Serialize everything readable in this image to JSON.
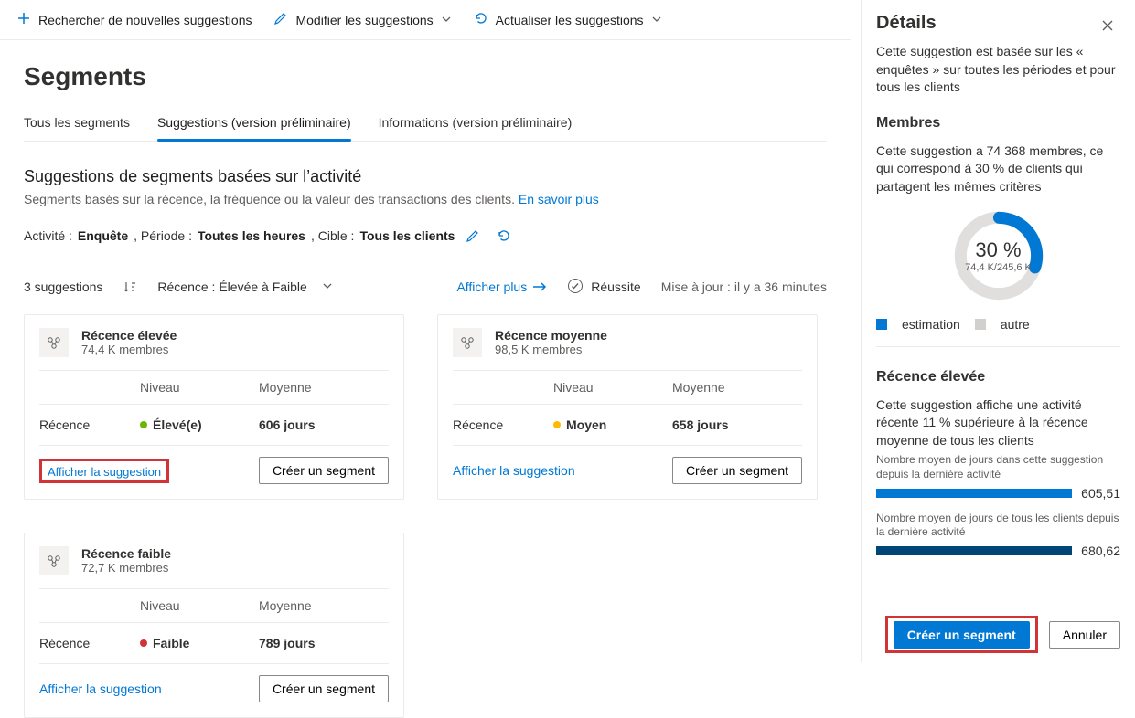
{
  "toolbar": {
    "search": "Rechercher de nouvelles suggestions",
    "modify": "Modifier les suggestions",
    "refresh": "Actualiser les suggestions"
  },
  "page": {
    "title": "Segments"
  },
  "tabs": {
    "all": "Tous les segments",
    "suggestions": "Suggestions (version préliminaire)",
    "insights": "Informations (version préliminaire)"
  },
  "section": {
    "title": "Suggestions de segments basées sur l’activité",
    "desc": "Segments basés sur la récence, la fréquence ou la valeur des transactions des clients. ",
    "learn_more": "En savoir plus"
  },
  "filters": {
    "activity_label": "Activité : ",
    "activity_value": "Enquête",
    "period_label": ", Période : ",
    "period_value": "Toutes les heures",
    "target_label": ", Cible : ",
    "target_value": "Tous les clients"
  },
  "list": {
    "count_text": "3 suggestions",
    "sort_text": "Récence : Élevée à Faible",
    "show_more": "Afficher plus",
    "status": "Réussite",
    "updated_label": "Mise à jour : ",
    "updated_value": "il y a 36 minutes"
  },
  "headers": {
    "level": "Niveau",
    "avg": "Moyenne",
    "rec": "Récence"
  },
  "card_actions": {
    "view": "Afficher la suggestion",
    "create": "Créer un segment"
  },
  "cards": [
    {
      "title": "Récence élevée",
      "members": "74,4 K membres",
      "level": "Élevé(e)",
      "avg": "606 jours",
      "dot": "green",
      "highlighted": true
    },
    {
      "title": "Récence moyenne",
      "members": "98,5 K membres",
      "level": "Moyen",
      "avg": "658 jours",
      "dot": "yellow",
      "highlighted": false
    },
    {
      "title": "Récence faible",
      "members": "72,7 K membres",
      "level": "Faible",
      "avg": "789 jours",
      "dot": "red",
      "highlighted": false
    }
  ],
  "pane": {
    "title": "Détails",
    "intro": "Cette suggestion est basée sur les « enquêtes » sur toutes les périodes et pour tous les clients",
    "members_title": "Membres",
    "members_desc": "Cette suggestion a 74 368 membres, ce qui correspond à 30 % de clients qui partagent les mêmes critères",
    "donut_pct": "30 %",
    "donut_sub": "74,4 K/245,6 K",
    "legend_est": "estimation",
    "legend_other": "autre",
    "rec_title": "Récence élevée",
    "rec_desc": "Cette suggestion affiche une activité récente 11 % supérieure à la récence moyenne de tous les clients",
    "metric1_label": "Nombre moyen de jours dans cette suggestion depuis la dernière activité",
    "metric1_value": "605,51",
    "metric2_label": "Nombre moyen de jours de tous les clients depuis la dernière activité",
    "metric2_value": "680,62",
    "create": "Créer un segment",
    "cancel": "Annuler"
  },
  "chart_data": {
    "type": "pie",
    "title": "Membres",
    "series": [
      {
        "name": "estimation",
        "value": 74.4,
        "pct": 30,
        "color": "#0078d4"
      },
      {
        "name": "autre",
        "value": 171.2,
        "pct": 70,
        "color": "#d2d0ce"
      }
    ],
    "total": 245.6,
    "unit": "K"
  }
}
